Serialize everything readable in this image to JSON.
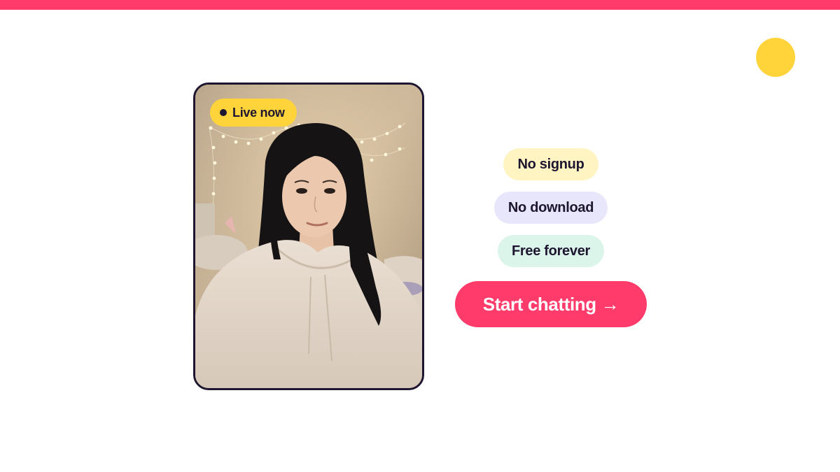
{
  "colors": {
    "accent": "#ff3b6b",
    "yellow": "#ffd43b",
    "dark": "#1e1630",
    "pill_signup_bg": "#fff4c2",
    "pill_download_bg": "#e8e6fb",
    "pill_free_bg": "#dcf5ea"
  },
  "photo": {
    "live_label": "Live now",
    "live_icon": "live-dot-icon"
  },
  "features": [
    {
      "label": "No signup"
    },
    {
      "label": "No download"
    },
    {
      "label": "Free forever"
    }
  ],
  "cta": {
    "label": "Start chatting →"
  }
}
